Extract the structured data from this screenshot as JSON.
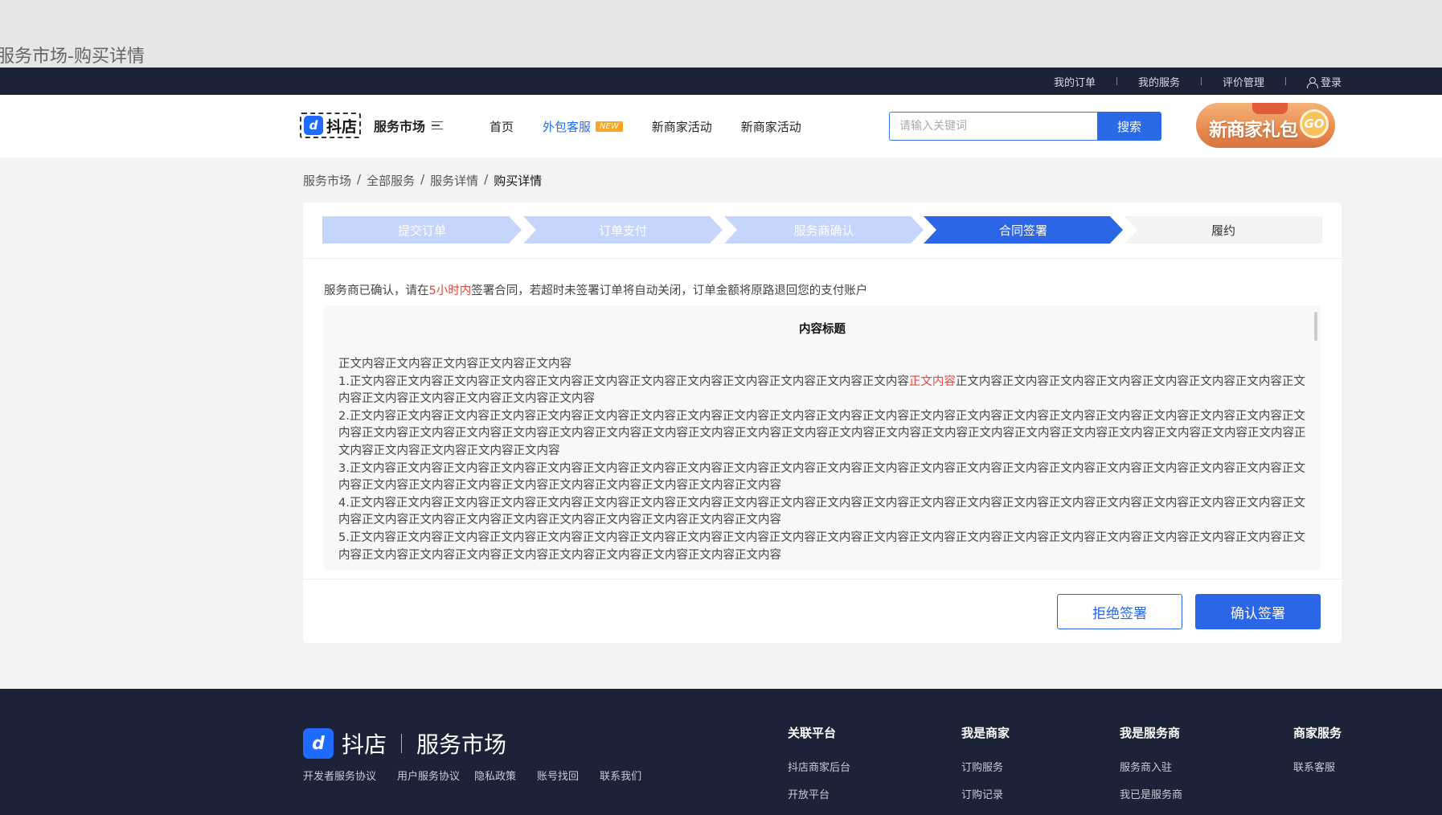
{
  "page_label": "服务市场-购买详情",
  "topbar": {
    "my_orders": "我的订单",
    "my_services": "我的服务",
    "reviews": "评价管理",
    "login": "登录"
  },
  "header": {
    "logo_mark": "d",
    "logo_text": "抖店",
    "logo_sub": "服务市场",
    "nav": [
      "首页",
      "外包客服",
      "新商家活动",
      "新商家活动"
    ],
    "new_badge": "NEW",
    "search_placeholder": "请输入关键词",
    "search_button": "搜索",
    "gift_text": "新商家礼包",
    "gift_go": "GO"
  },
  "breadcrumb": [
    "服务市场",
    "全部服务",
    "服务详情",
    "购买详情"
  ],
  "breadcrumb_sep": "/",
  "steps": [
    "提交订单",
    "订单支付",
    "服务商确认",
    "合同签署",
    "履约"
  ],
  "notice": {
    "before": "服务商已确认，请在",
    "highlight": "5小时内",
    "after": "签署合同，若超时未签署订单将自动关闭，订单金额将原路退回您的支付账户"
  },
  "contract": {
    "title": "内容标题",
    "intro": "正文内容正文内容正文内容正文内容正文内容",
    "p1_before": "1.正文内容正文内容正文内容正文内容正文内容正文内容正文内容正文内容正文内容正文内容正文内容正文内容",
    "p1_red": "正文内容",
    "p1_after": "正文内容正文内容正文内容正文内容正文内容正文内容正文内容正文内容正文内容正文内容正文内容正文内容正文内容",
    "p2": "2.正文内容正文内容正文内容正文内容正文内容正文内容正文内容正文内容正文内容正文内容正文内容正文内容正文内容正文内容正文内容正文内容正文内容正文内容正文内容正文内容正文内容正文内容正文内容正文内容正文内容正文内容正文内容正文内容正文内容正文内容正文内容正文内容正文内容正文内容正文内容正文内容正文内容正文内容正文内容正文内容正文内容正文内容正文内容正文内容正文内容正文内容",
    "p3": "3.正文内容正文内容正文内容正文内容正文内容正文内容正文内容正文内容正文内容正文内容正文内容正文内容正文内容正文内容正文内容正文内容正文内容正文内容正文内容正文内容正文内容正文内容正文内容正文内容正文内容正文内容正文内容正文内容正文内容正文内容",
    "p4": "4.正文内容正文内容正文内容正文内容正文内容正文内容正文内容正文内容正文内容正文内容正文内容正文内容正文内容正文内容正文内容正文内容正文内容正文内容正文内容正文内容正文内容正文内容正文内容正文内容正文内容正文内容正文内容正文内容正文内容正文内容",
    "p5": "5.正文内容正文内容正文内容正文内容正文内容正文内容正文内容正文内容正文内容正文内容正文内容正文内容正文内容正文内容正文内容正文内容正文内容正文内容正文内容正文内容正文内容正文内容正文内容正文内容正文内容正文内容正文内容正文内容正文内容正文内容"
  },
  "actions": {
    "reject": "拒绝签署",
    "confirm": "确认签署"
  },
  "footer": {
    "logo_mark": "d",
    "logo_name": "抖店",
    "logo_sub": "服务市场",
    "links": [
      "开发者服务协议",
      "用户服务协议",
      "隐私政策",
      "账号找回",
      "联系我们"
    ],
    "columns": [
      {
        "title": "关联平台",
        "items": [
          "抖店商家后台",
          "开放平台"
        ]
      },
      {
        "title": "我是商家",
        "items": [
          "订购服务",
          "订购记录"
        ]
      },
      {
        "title": "我是服务商",
        "items": [
          "服务商入驻",
          "我已是服务商"
        ]
      },
      {
        "title": "商家服务",
        "items": [
          "联系客服"
        ]
      }
    ]
  },
  "colors": {
    "primary": "#2b66e6",
    "highlight_red": "#e0463a",
    "dark_bg": "#1c2238",
    "new_badge": "#f6a623"
  }
}
